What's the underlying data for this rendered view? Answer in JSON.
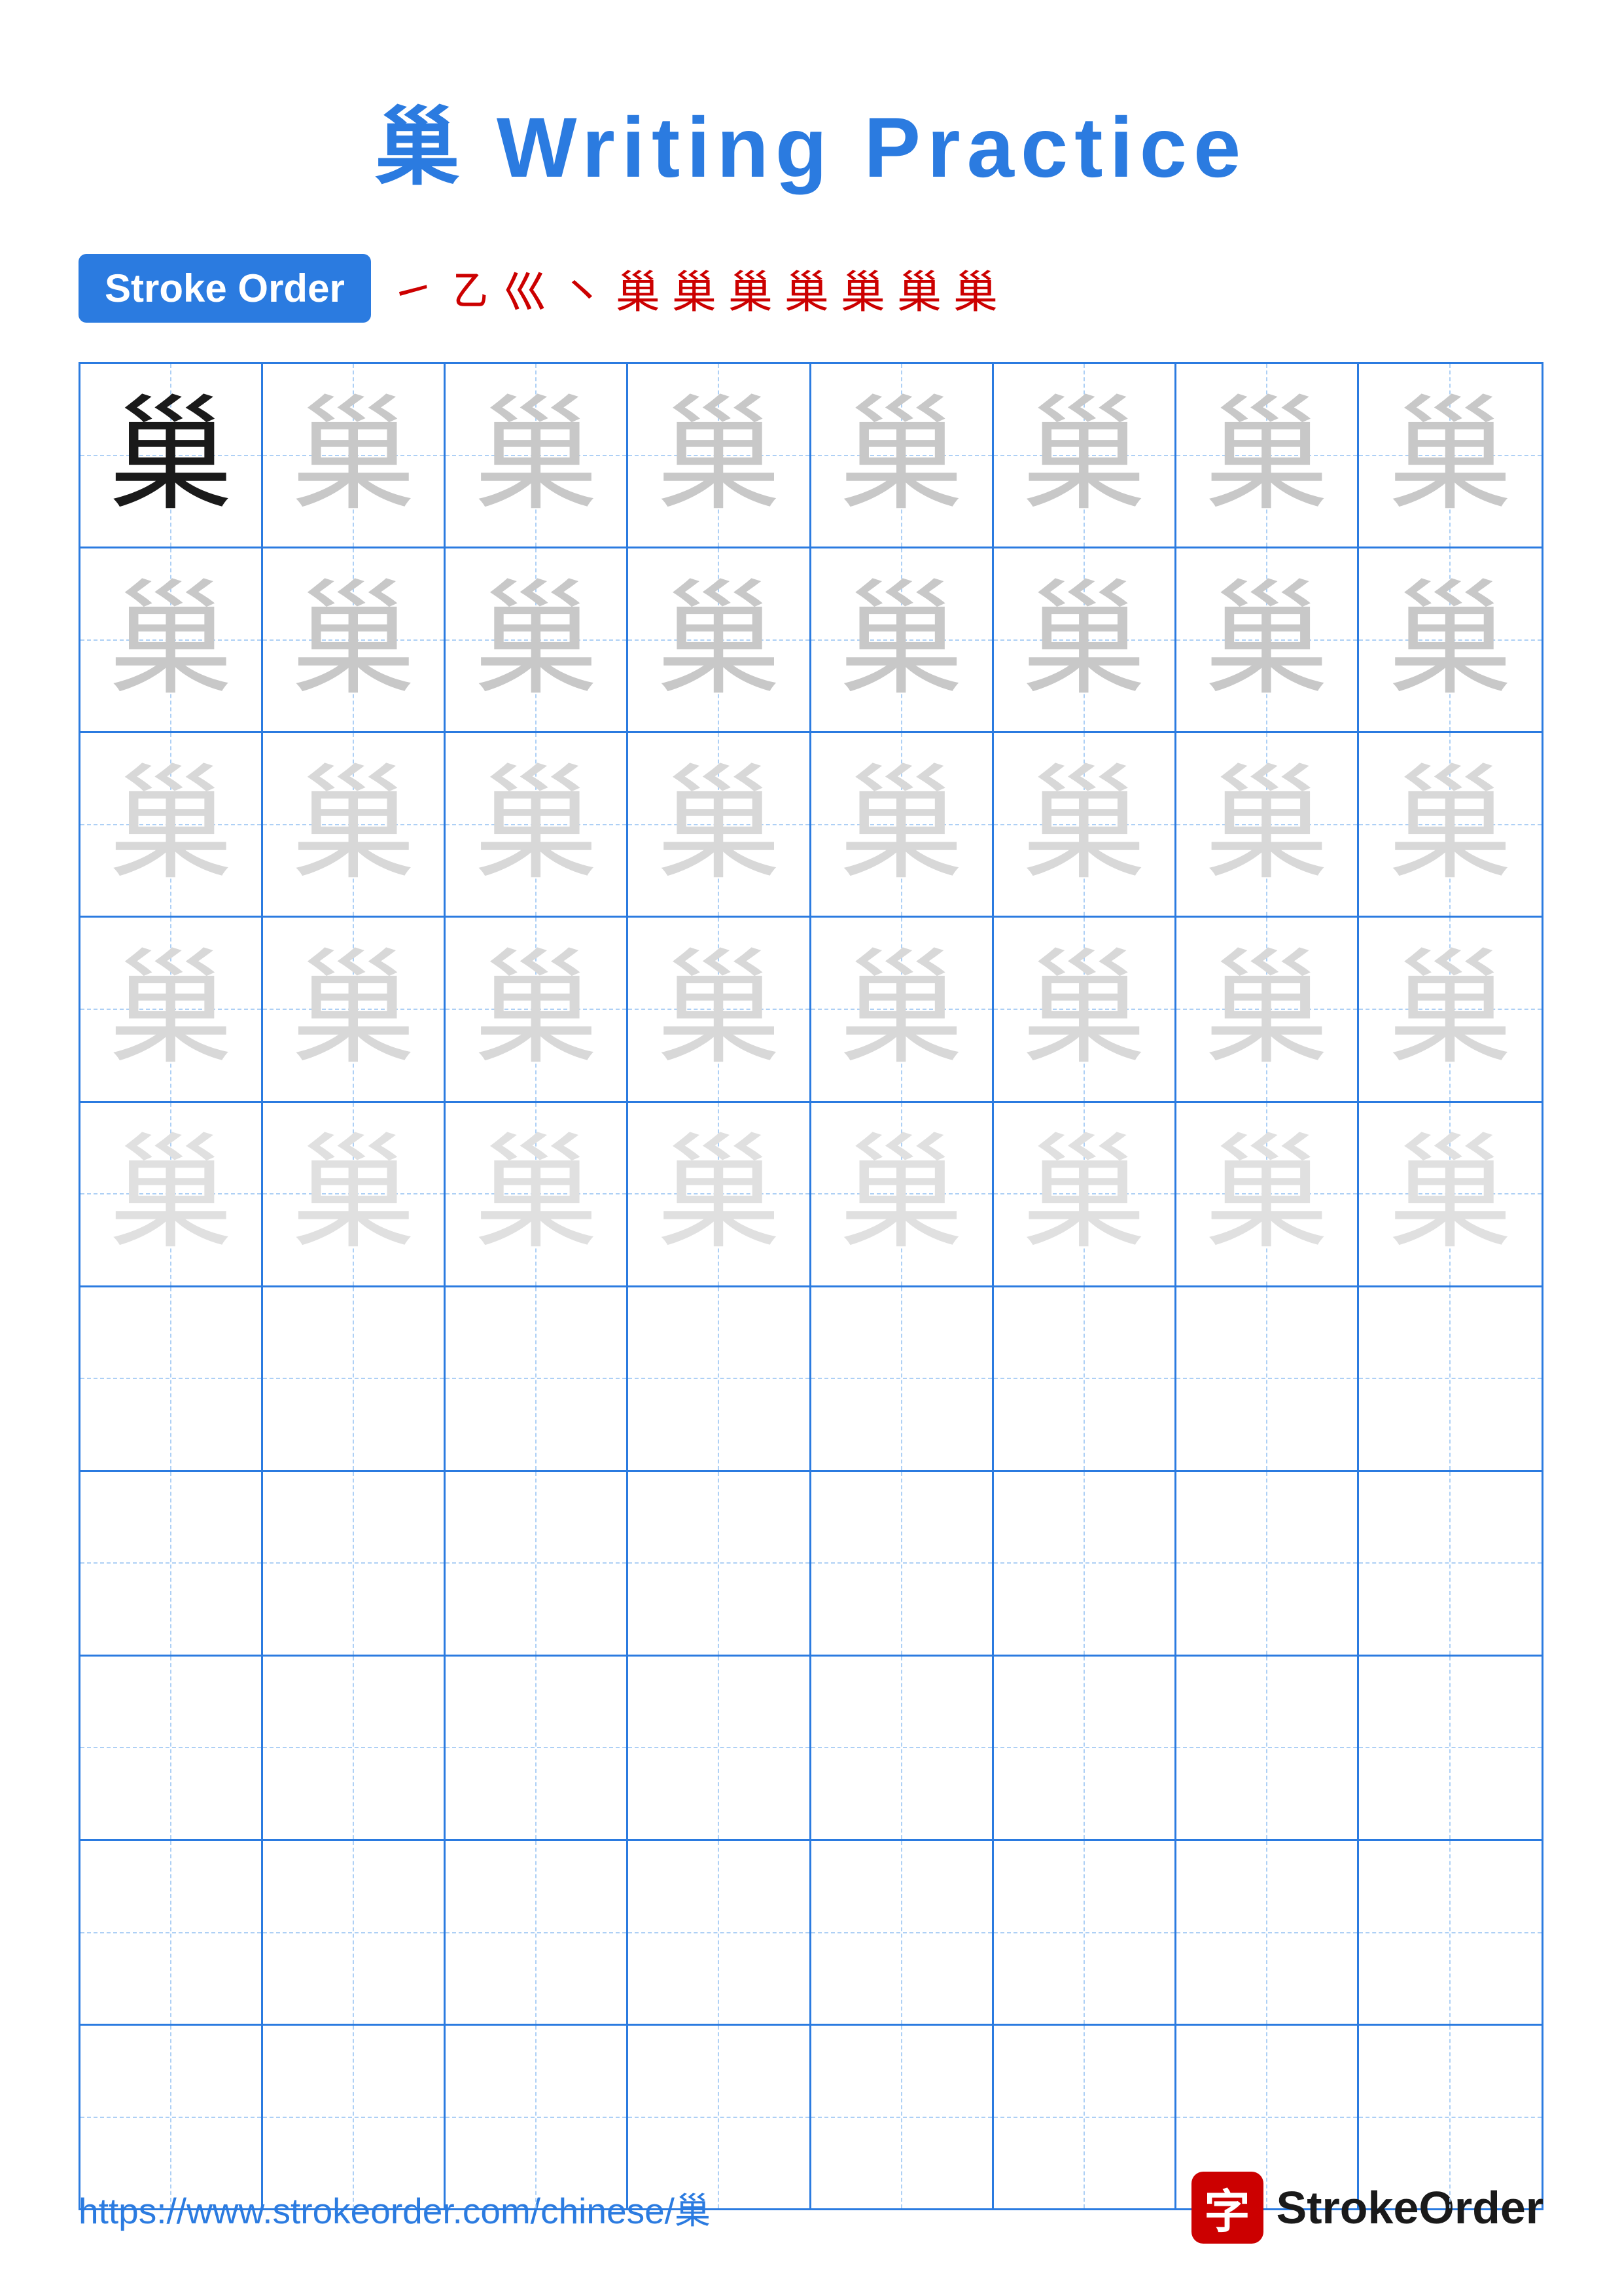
{
  "title": {
    "char": "巢",
    "text": " Writing Practice"
  },
  "stroke_order": {
    "badge_label": "Stroke Order",
    "chars": [
      "㇀",
      "㇠",
      "巛",
      "㇔",
      "巢",
      "巢",
      "巢",
      "巢",
      "巢",
      "巢",
      "巢"
    ]
  },
  "grid": {
    "rows": 10,
    "cols": 8,
    "char": "巢"
  },
  "footer": {
    "url": "https://www.strokeorder.com/chinese/巢",
    "logo_char": "字",
    "logo_text": "StrokeOrder"
  }
}
